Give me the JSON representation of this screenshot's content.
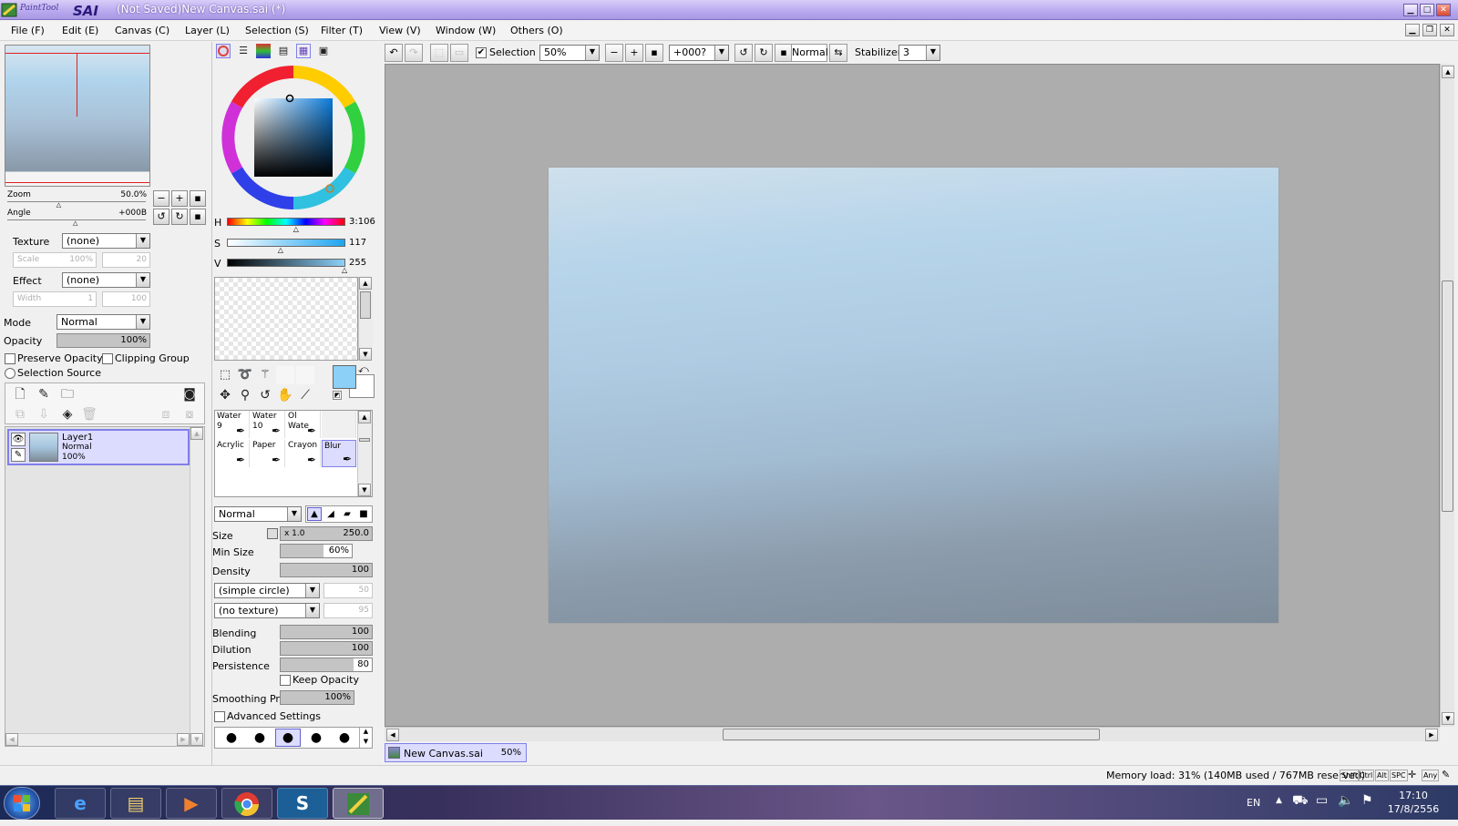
{
  "window": {
    "app_name": "PaintTool SAI",
    "title": "(Not Saved)New Canvas.sai (*)"
  },
  "menu": [
    "File (F)",
    "Edit (E)",
    "Canvas (C)",
    "Layer (L)",
    "Selection (S)",
    "Filter (T)",
    "View (V)",
    "Window (W)",
    "Others (O)"
  ],
  "navigator": {
    "zoom_label": "Zoom",
    "zoom_value": "50.0%",
    "zoom_level": 0.38,
    "angle_label": "Angle",
    "angle_value": "+000B",
    "angle_level": 0.5
  },
  "layer_props": {
    "texture_label": "Texture",
    "texture_value": "(none)",
    "scale_label": "Scale",
    "scale_value": "100%",
    "scale_num": "20",
    "effect_label": "Effect",
    "effect_value": "(none)",
    "width_label": "Width",
    "width_value": "1",
    "width_num": "100",
    "mode_label": "Mode",
    "mode_value": "Normal",
    "opacity_label": "Opacity",
    "opacity_value": "100%",
    "preserve_opacity": "Preserve Opacity",
    "clipping_group": "Clipping Group",
    "selection_source": "Selection Source"
  },
  "layers": [
    {
      "name": "Layer1",
      "mode": "Normal",
      "opacity": "100%"
    }
  ],
  "color": {
    "h_label": "H",
    "h_value": "3:106",
    "h_level": 0.59,
    "s_label": "S",
    "s_value": "117",
    "s_level": 0.46,
    "v_label": "V",
    "v_value": "255",
    "v_level": 1.0,
    "primary": "#8ccff7",
    "secondary": "#ffffff"
  },
  "brushes": [
    {
      "name": "Water",
      "size": "9"
    },
    {
      "name": "Water",
      "size": "10"
    },
    {
      "name": "Ol Wate",
      "size": ""
    },
    {
      "name": "",
      "size": ""
    },
    {
      "name": "Acrylic",
      "size": ""
    },
    {
      "name": "Paper",
      "size": ""
    },
    {
      "name": "Crayon",
      "size": ""
    },
    {
      "name": "Blur",
      "size": ""
    }
  ],
  "brush_settings": {
    "blend_mode": "Normal",
    "size_label": "Size",
    "size_mult": "x 1.0",
    "size_value": "250.0",
    "minsize_label": "Min Size",
    "minsize_value": "60%",
    "minsize_level": 0.6,
    "density_label": "Density",
    "density_value": "100",
    "shape_value": "(simple circle)",
    "shape_num": "50",
    "texture_value": "(no texture)",
    "texture_num": "95",
    "blending_label": "Blending",
    "blending_value": "100",
    "dilution_label": "Dilution",
    "dilution_value": "100",
    "persistence_label": "Persistence",
    "persistence_value": "80",
    "persistence_level": 0.8,
    "keep_opacity": "Keep Opacity",
    "smoothing_label": "Smoothing Prs",
    "smoothing_value": "100%",
    "advanced": "Advanced Settings"
  },
  "toolbar": {
    "selection_label": "Selection",
    "zoom_value": "50%",
    "angle_value": "+000?",
    "blend_value": "Normal",
    "stabilizer_label": "Stabilizer",
    "stabilizer_value": "3"
  },
  "canvas_tab": {
    "name": "New Canvas.sai",
    "zoom": "50%"
  },
  "status": {
    "memory": "Memory load: 31% (140MB used / 767MB reserved)",
    "keys": [
      "Shift",
      "Ctrl",
      "Alt",
      "SPC",
      "Any"
    ]
  },
  "taskbar": {
    "lang": "EN",
    "time": "17:10",
    "date": "17/8/2556"
  }
}
